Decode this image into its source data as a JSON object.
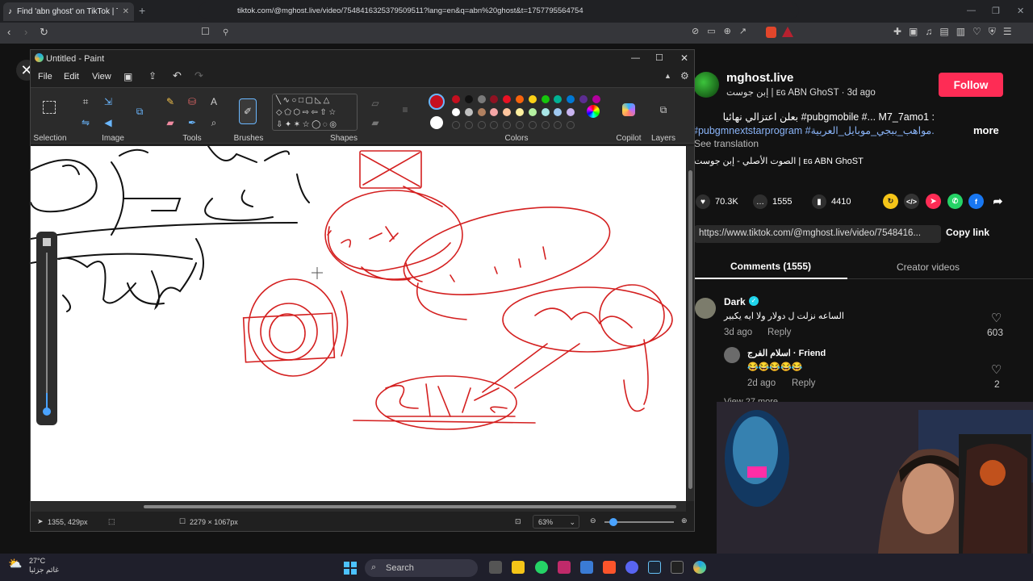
{
  "browser": {
    "tab_title": "Find 'abn ghost' on TikTok | TikTok",
    "url": "tiktok.com/@mghost.live/video/7548416325379509511?lang=en&q=abn%20ghost&t=1757795564754"
  },
  "paint": {
    "title": "Untitled - Paint",
    "menu": [
      "File",
      "Edit",
      "View"
    ],
    "groups": {
      "selection": "Selection",
      "image": "Image",
      "tools": "Tools",
      "brushes": "Brushes",
      "shapes": "Shapes",
      "colors": "Colors",
      "copilot": "Copilot",
      "layers": "Layers"
    },
    "colors_row1": [
      "#c50f1f",
      "#111111",
      "#7a7a7a",
      "#8f1222",
      "#e81123",
      "#f7630c",
      "#fcd116",
      "#16c60c",
      "#00b294",
      "#0078d4",
      "#5c2d91",
      "#b4009e"
    ],
    "colors_row2": [
      "#ffffff",
      "#c0c0c0",
      "#b08060",
      "#f4a6a6",
      "#ffc59e",
      "#fff0a0",
      "#b4f0a0",
      "#a8e6e6",
      "#9fc8f0",
      "#c8b4f0"
    ],
    "status": {
      "cursor": "1355, 429px",
      "size": "2279 × 1067px",
      "zoom": "63%"
    }
  },
  "tiktok": {
    "username": "mghost.live",
    "subline": "إبن جوست | ᴇɢ ABN GhoST · 3d ago",
    "follow_label": "Follow",
    "desc_line1": "بعلن اعتزالي نهائيا #pubgmobile #... M7_7amo1 :",
    "desc_line2": "#pubgmnextstarprogram #مواهب_ببجي_موبايل_العربية...",
    "more_label": "more",
    "see_translation": "See translation",
    "sound": "الصوت الأصلي - إبن جوست | ᴇɢ ABN GhoST",
    "likes": "70.3K",
    "comments_count": "1555",
    "saves": "4410",
    "link": "https://www.tiktok.com/@mghost.live/video/7548416...",
    "copy_link": "Copy link",
    "tab_comments": "Comments (1555)",
    "tab_creator": "Creator videos",
    "comments": [
      {
        "name": "Dark",
        "text": "الساعه نزلت ل دولار ولا ايه يكبير",
        "date": "3d ago",
        "reply": "Reply",
        "likes": "603"
      },
      {
        "name": "اسلام الفرج · Friend",
        "text": "😂😂😂😂😂",
        "date": "2d ago",
        "reply": "Reply",
        "likes": "2"
      }
    ],
    "view_more": "View 27 more"
  },
  "taskbar": {
    "temp": "27°C",
    "weather_text": "غائم جزئيا",
    "search": "Search"
  }
}
